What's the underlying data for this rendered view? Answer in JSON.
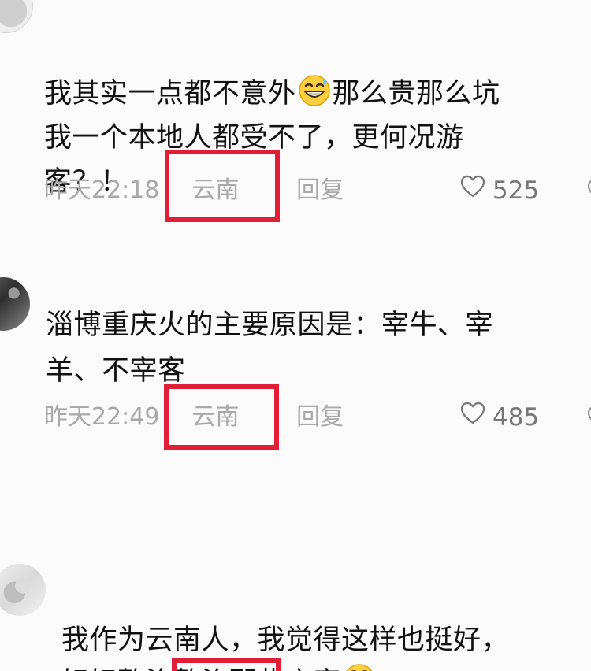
{
  "comments": [
    {
      "text_before_emoji": "我其实一点都不意外",
      "text_after_emoji": "那么贵那么坑\n我一个本地人都受不了，更何况游\n客？！",
      "emoji": "grin-sweat-emoji",
      "meta": {
        "time": "昨天22:18",
        "location": "云南",
        "reply": "回复",
        "likes": "525"
      }
    },
    {
      "text": "淄博重庆火的主要原因是：宰牛、宰\n羊、不宰客",
      "meta": {
        "time": "昨天22:49",
        "location": "云南",
        "reply": "回复",
        "likes": "485"
      }
    },
    {
      "text_before_emoji": "我作为云南人，我觉得这样也挺好，\n好好整治整治那些商家",
      "emoji": "wide-eyed-smile-emoji"
    }
  ],
  "colors": {
    "highlight": "#e11d37",
    "meta": "#a8a8a8",
    "likes": "#777777"
  },
  "icons": {
    "like": "heart-outline-icon",
    "dislike": "broken-heart-outline-icon"
  }
}
